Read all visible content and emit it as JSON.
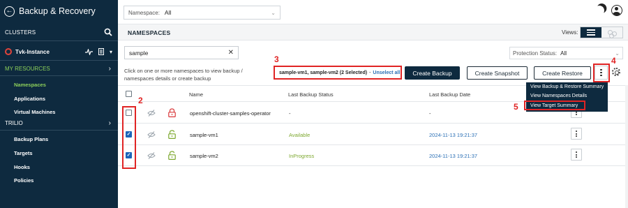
{
  "sidebar": {
    "app_title": "Backup & Recovery",
    "clusters_label": "CLUSTERS",
    "instance_label": "Tvk-Instance",
    "my_resources_label": "MY RESOURCES",
    "my_resources_items": [
      "Namespaces",
      "Applications",
      "Virtual Machines"
    ],
    "trilio_label": "TRILIO",
    "trilio_items": [
      "Backup Plans",
      "Targets",
      "Hooks",
      "Policies"
    ],
    "accent_color": "#8ccf5a",
    "bg_color": "#0e2a3f"
  },
  "topbar": {
    "namespace_label": "Namespace:",
    "namespace_value": "All"
  },
  "section": {
    "title": "NAMESPACES",
    "views_label": "Views:"
  },
  "filters": {
    "search_value": "sample",
    "protection_label": "Protection Status:",
    "protection_value": "All"
  },
  "actions": {
    "hint": "Click on one or more namespaces to view backup / namespaces details or create backup",
    "selection_text": "sample-vm1, sample-vm2 (2 Selected)",
    "selection_sep": "-",
    "unselect_label": "Unselect all",
    "create_backup": "Create Backup",
    "create_snapshot": "Create Snapshot",
    "create_restore": "Create Restore"
  },
  "menu": {
    "items": [
      "View Backup & Restore Summary",
      "View Namespaces Details",
      "View Target Summary"
    ]
  },
  "callouts": {
    "c2": "2",
    "c3": "3",
    "c4": "4",
    "c5": "5"
  },
  "table": {
    "columns": [
      "Name",
      "Last Backup Status",
      "Last Backup Date"
    ],
    "rows": [
      {
        "name": "openshift-cluster-samples-operator",
        "status": "-",
        "date": "-",
        "checked": false,
        "locked": true
      },
      {
        "name": "sample-vm1",
        "status": "Available",
        "date": "2024-11-13 19:21:37",
        "checked": true,
        "locked": false
      },
      {
        "name": "sample-vm2",
        "status": "InProgress",
        "date": "2024-11-13 19:21:37",
        "checked": true,
        "locked": false
      }
    ]
  },
  "colors": {
    "highlight": "#e02424",
    "link": "#2a6fb5",
    "checkbox": "#1d63b8"
  }
}
